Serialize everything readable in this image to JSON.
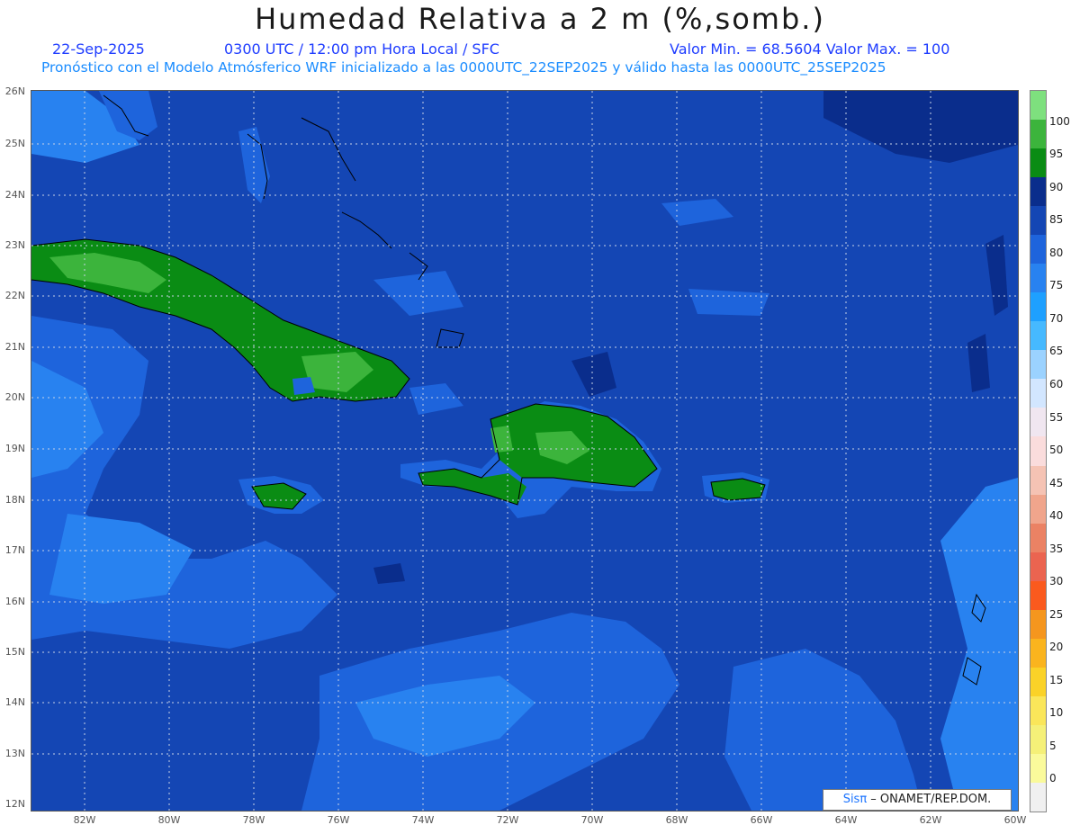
{
  "header": {
    "title": "Humedad Relativa a 2 m (%,somb.)",
    "date": "22-Sep-2025",
    "time": "0300 UTC / 12:00 pm Hora Local / SFC",
    "minmax": "Valor Min. = 68.5604  Valor Max. = 100",
    "forecast": "Pronóstico con el Modelo Atmósferico WRF inicializado a las 0000UTC_22SEP2025 y válido hasta las  0000UTC_25SEP2025"
  },
  "axes": {
    "lat_labels": [
      "26N",
      "25N",
      "24N",
      "23N",
      "22N",
      "21N",
      "20N",
      "19N",
      "18N",
      "17N",
      "16N",
      "15N",
      "14N",
      "13N",
      "12N"
    ],
    "lon_labels": [
      "82W",
      "80W",
      "78W",
      "76W",
      "74W",
      "72W",
      "70W",
      "68W",
      "66W",
      "64W",
      "62W",
      "60W"
    ]
  },
  "colorbar": {
    "labels": [
      "100",
      "95",
      "90",
      "85",
      "80",
      "75",
      "70",
      "65",
      "60",
      "55",
      "50",
      "45",
      "40",
      "35",
      "30",
      "25",
      "20",
      "15",
      "10",
      "5",
      "0"
    ],
    "colors_top_to_bottom": [
      "#7ee07e",
      "#3cb43c",
      "#0a8c14",
      "#0a2d8c",
      "#1446b4",
      "#1e64dc",
      "#2882f0",
      "#1ea0ff",
      "#46b9ff",
      "#9bd2ff",
      "#d2e6ff",
      "#f0e6f0",
      "#fadcdc",
      "#f5c3b4",
      "#f0a58c",
      "#eb8264",
      "#eb6450",
      "#fa5a1e",
      "#f5961e",
      "#fab41e",
      "#fad228",
      "#fae65a",
      "#f5f078",
      "#fafa9b",
      "#f0f0f0"
    ]
  },
  "credit": {
    "sis": "Sisπ",
    "text": " – ONAMET/REP.DOM."
  },
  "map_colors": {
    "ocean": "#1446b4",
    "dark": "#0a2d8c",
    "mid": "#1e64dc",
    "light": "#2882f0",
    "land": "#0a8c14",
    "land_light": "#3cb43c",
    "land_pale": "#7ee07e"
  }
}
